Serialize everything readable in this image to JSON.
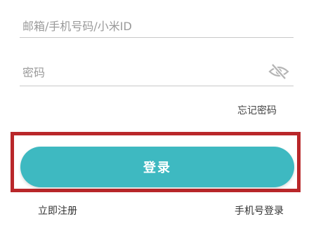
{
  "form": {
    "account_placeholder": "邮箱/手机号码/小米ID",
    "account_value": "",
    "password_placeholder": "密码",
    "password_value": "",
    "password_toggle_icon": "eye-slash-icon",
    "forgot_password_label": "忘记密码",
    "login_button_label": "登录"
  },
  "footer": {
    "register_label": "立即注册",
    "phone_login_label": "手机号登录"
  },
  "colors": {
    "accent": "#3eb9c1",
    "highlight_border": "#b9272a"
  }
}
